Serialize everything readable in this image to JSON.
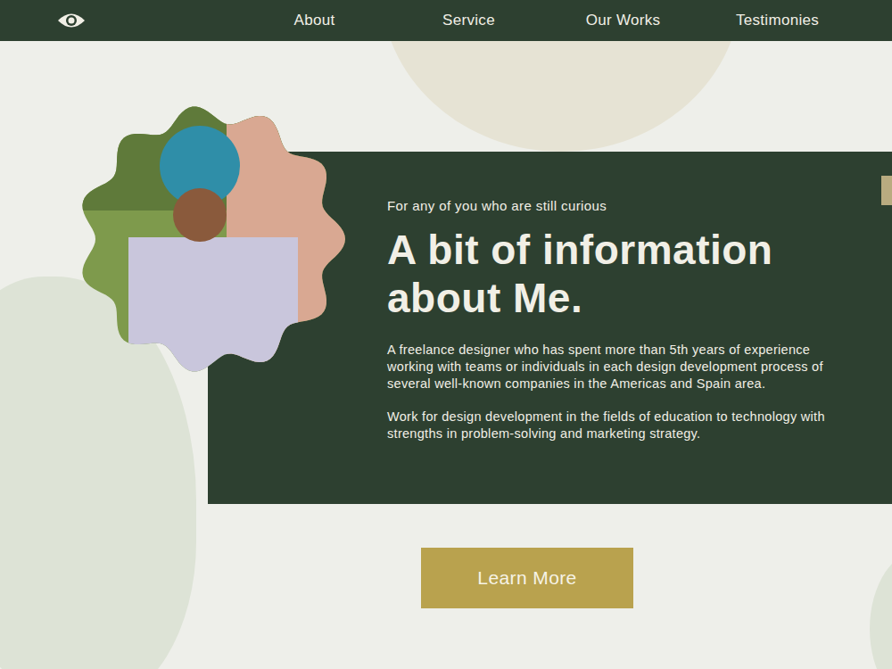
{
  "nav": {
    "items": [
      "About",
      "Service",
      "Our Works",
      "Testimonies"
    ]
  },
  "about": {
    "eyebrow": "For any of you who are still curious",
    "title": "A bit of information about Me.",
    "paragraphs": [
      "A freelance designer who has spent more than 5th years of experience working with teams or individuals in each design development process of several well-known companies in the Americas and Spain area.",
      "Work for design development in the fields of education to technology with strengths in problem-solving and marketing strategy."
    ]
  },
  "button": {
    "label": "Learn More"
  }
}
